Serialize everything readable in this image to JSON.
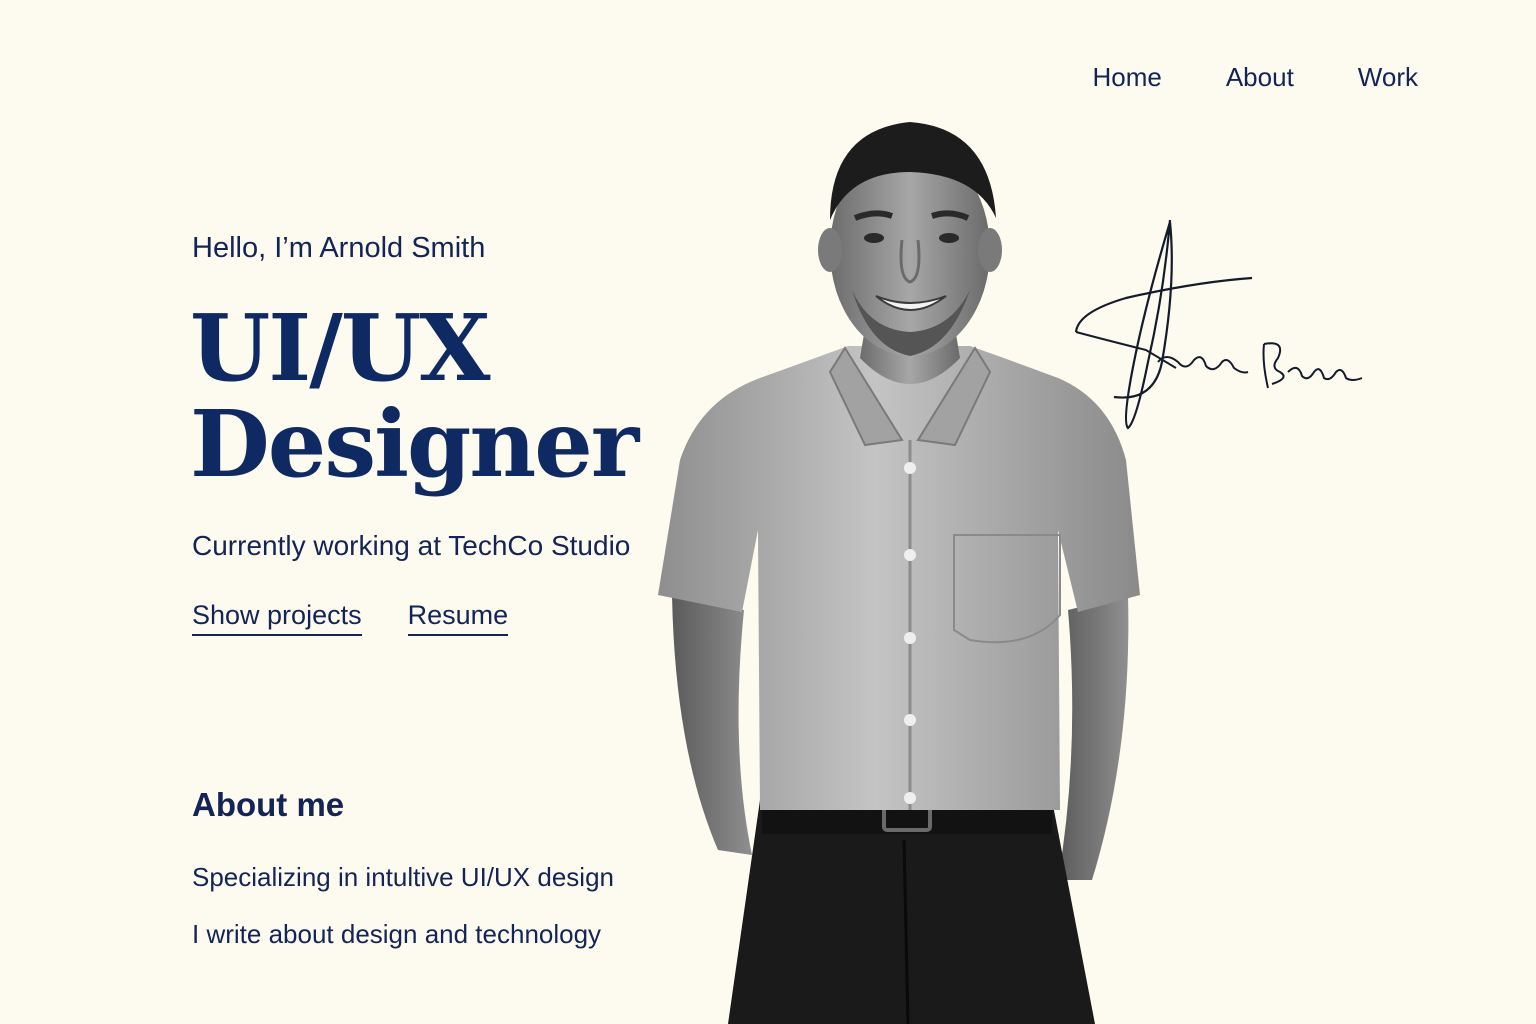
{
  "nav": {
    "items": [
      {
        "label": "Home"
      },
      {
        "label": "About"
      },
      {
        "label": "Work"
      }
    ]
  },
  "hero": {
    "greeting": "Hello, I’m Arnold Smith",
    "title_line1": "UI/UX",
    "title_line2": "Designer",
    "subtitle": "Currently working at TechCo Studio",
    "show_projects_label": "Show projects",
    "resume_label": "Resume"
  },
  "about": {
    "title": "About me",
    "line1": "Specializing in intultive UI/UX design",
    "line2": "I write about design and technology"
  },
  "images": {
    "portrait": "portrait-photo",
    "signature": "handwritten-signature"
  },
  "colors": {
    "background": "#fdfaef",
    "text": "#142456",
    "headline": "#0f2a63"
  }
}
